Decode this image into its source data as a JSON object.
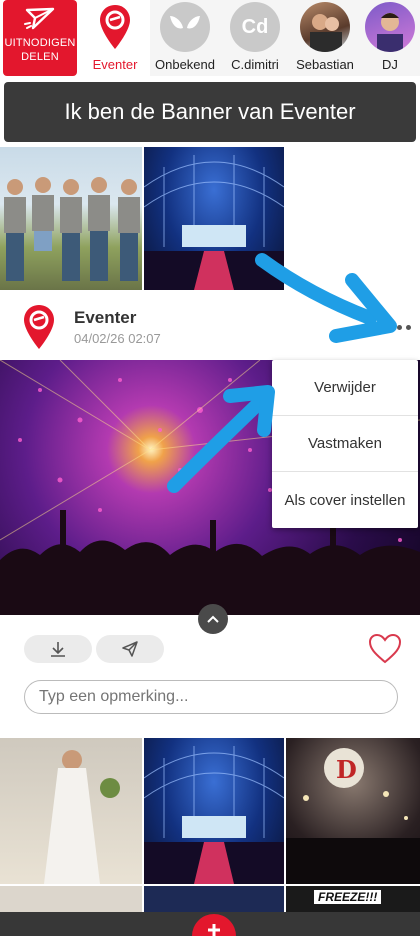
{
  "participants_bar": {
    "invite_label_1": "UITNODIGEN",
    "invite_label_2": "DELEN",
    "people": [
      {
        "name": "Eventer",
        "type": "logo",
        "active": true
      },
      {
        "name": "Onbekend",
        "type": "alien"
      },
      {
        "name": "C.dimitri",
        "type": "initials",
        "initials": "Cd"
      },
      {
        "name": "Sebastian",
        "type": "photo"
      },
      {
        "name": "DJ",
        "type": "photo"
      }
    ]
  },
  "banner": {
    "text": "Ik ben de Banner van Eventer"
  },
  "post": {
    "author": "Eventer",
    "date": "04/02/26 02:07",
    "menu": [
      "Verwijder",
      "Vastmaken",
      "Als cover instellen"
    ],
    "comment_placeholder": "Typ een opmerking...",
    "bottom_photo_sign": "FREEZE!!!",
    "balloon_letter": "D"
  },
  "colors": {
    "accent": "#e3172d",
    "banner_bg": "#3a3a3a",
    "arrow": "#1f9ee6"
  },
  "icons": [
    "paper-plane-icon",
    "map-pin-icon",
    "more-dots-icon",
    "download-icon",
    "send-icon",
    "heart-icon",
    "chevron-up-icon"
  ]
}
